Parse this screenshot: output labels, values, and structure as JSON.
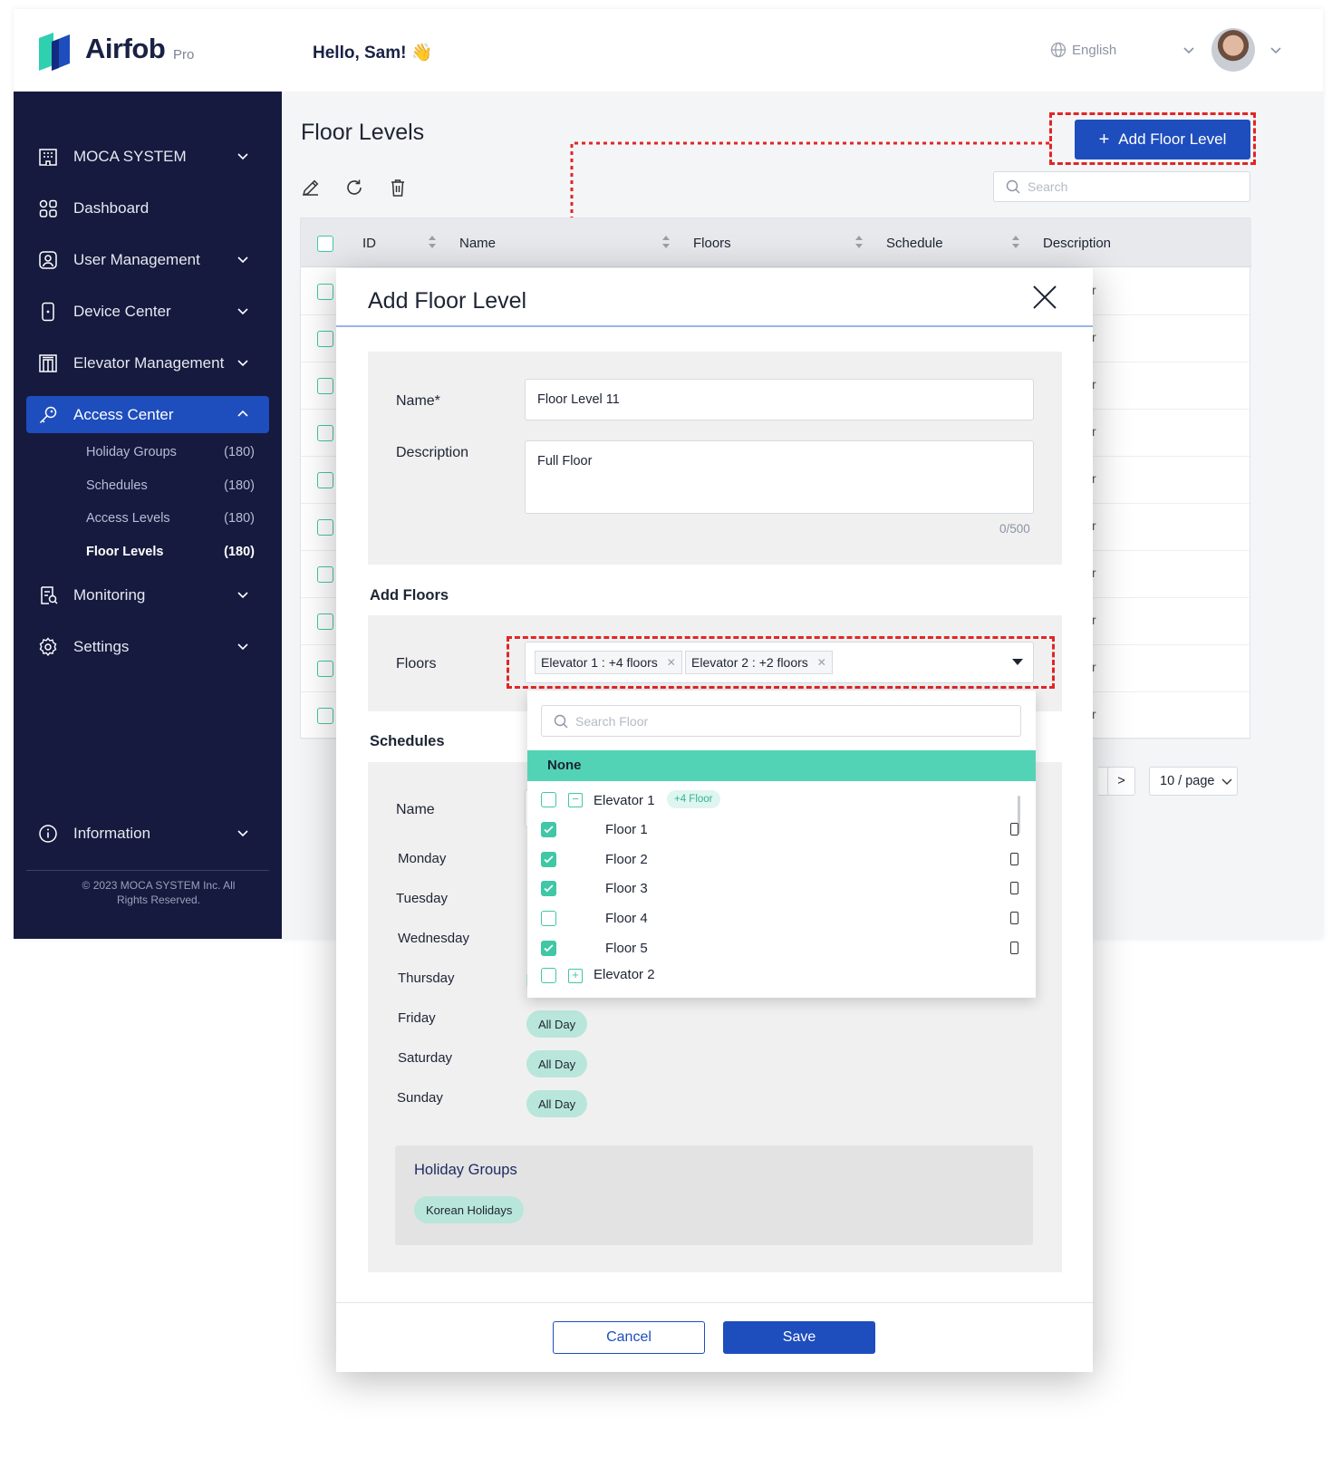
{
  "brand": {
    "name": "Airfob",
    "edition": "Pro"
  },
  "header": {
    "greeting": "Hello, Sam! 👋",
    "language": "English"
  },
  "sidebar": {
    "items": [
      {
        "label": "MOCA SYSTEM",
        "icon": "building-icon"
      },
      {
        "label": "Dashboard",
        "icon": "grid-icon"
      },
      {
        "label": "User Management",
        "icon": "user-icon"
      },
      {
        "label": "Device Center",
        "icon": "device-icon"
      },
      {
        "label": "Elevator Management",
        "icon": "elevator-icon"
      },
      {
        "label": "Access Center",
        "icon": "key-icon"
      },
      {
        "label": "Monitoring",
        "icon": "monitor-icon"
      },
      {
        "label": "Settings",
        "icon": "gear-icon"
      },
      {
        "label": "Information",
        "icon": "info-icon"
      }
    ],
    "subitems": [
      {
        "label": "Holiday Groups",
        "count": "(180)"
      },
      {
        "label": "Schedules",
        "count": "(180)"
      },
      {
        "label": "Access Levels",
        "count": "(180)"
      },
      {
        "label": "Floor Levels",
        "count": "(180)"
      }
    ],
    "copyright": "© 2023 MOCA SYSTEM Inc. All Rights Reserved."
  },
  "page": {
    "title": "Floor Levels",
    "add_button": "Add Floor Level",
    "search_placeholder": "Search"
  },
  "table": {
    "columns": [
      "ID",
      "Name",
      "Floors",
      "Schedule",
      "Description"
    ],
    "row_tail": "r",
    "row_count": 10
  },
  "pagination": {
    "next": ">",
    "page_size": "10 / page"
  },
  "modal": {
    "title": "Add Floor Level",
    "name_label": "Name*",
    "name_value": "Floor Level 11",
    "description_label": "Description",
    "description_value": "Full Floor",
    "char_count": "0/500",
    "add_floors_heading": "Add Floors",
    "floors_label": "Floors",
    "floor_tags": [
      "Elevator 1 : +4 floors",
      "Elevator 2 : +2 floors"
    ],
    "schedules_heading": "Schedules",
    "schedule_name_label": "Name",
    "days": [
      {
        "day": "Monday",
        "value": ""
      },
      {
        "day": "Tuesday",
        "value": ""
      },
      {
        "day": "Wednesday",
        "value": ""
      },
      {
        "day": "Thursday",
        "value": ""
      },
      {
        "day": "Friday",
        "value": "All Day"
      },
      {
        "day": "Saturday",
        "value": "All Day"
      },
      {
        "day": "Sunday",
        "value": "All Day"
      }
    ],
    "holiday_groups_heading": "Holiday Groups",
    "holiday_group": "Korean Holidays",
    "cancel": "Cancel",
    "save": "Save"
  },
  "dropdown": {
    "search_placeholder": "Search Floor",
    "none_option": "None",
    "elevator1": {
      "label": "Elevator 1",
      "badge": "+4 Floor"
    },
    "floors": [
      {
        "label": "Floor 1",
        "checked": true
      },
      {
        "label": "Floor 2",
        "checked": true
      },
      {
        "label": "Floor 3",
        "checked": true
      },
      {
        "label": "Floor 4",
        "checked": false
      },
      {
        "label": "Floor 5",
        "checked": true
      }
    ],
    "elevator2": {
      "label": "Elevator 2"
    }
  },
  "colors": {
    "sidebar": "#151a3e",
    "primary": "#1e4dbd",
    "accent": "#52d3b6",
    "annotation": "#e02626"
  }
}
